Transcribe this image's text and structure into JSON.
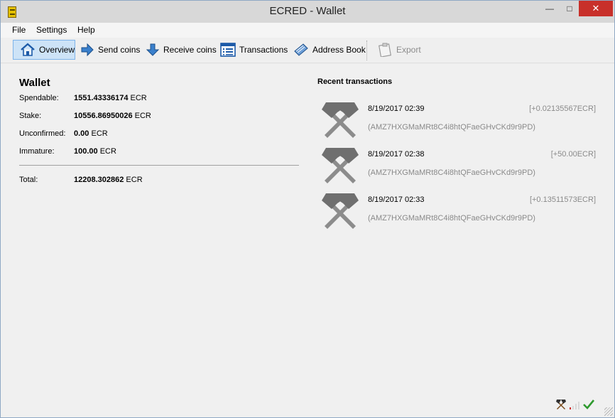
{
  "window": {
    "title": "ECRED - Wallet",
    "min_glyph": "—",
    "max_glyph": "□",
    "close_glyph": "✕"
  },
  "menu": {
    "items": [
      "File",
      "Settings",
      "Help"
    ]
  },
  "toolbar": {
    "overview": "Overview",
    "send": "Send coins",
    "receive": "Receive coins",
    "transactions": "Transactions",
    "address_book": "Address Book",
    "export": "Export"
  },
  "wallet": {
    "title": "Wallet",
    "spendable_label": "Spendable:",
    "spendable_value": "1551.43336174",
    "stake_label": "Stake:",
    "stake_value": "10556.86950026",
    "unconfirmed_label": "Unconfirmed:",
    "unconfirmed_value": "0.00",
    "immature_label": "Immature:",
    "immature_value": "100.00",
    "total_label": "Total:",
    "total_value": "12208.302862",
    "unit": "ECR"
  },
  "recent": {
    "title": "Recent transactions",
    "items": [
      {
        "date": "8/19/2017 02:39",
        "amount": "[+0.02135567",
        "unit": "ECR]",
        "address": "(AMZ7HXGMaMRt8C4i8htQFaeGHvCKd9r9PD)"
      },
      {
        "date": "8/19/2017 02:38",
        "amount": "[+50.00",
        "unit": "ECR]",
        "address": "(AMZ7HXGMaMRt8C4i8htQFaeGHvCKd9r9PD)"
      },
      {
        "date": "8/19/2017 02:33",
        "amount": "[+0.13511573",
        "unit": "ECR]",
        "address": "(AMZ7HXGMaMRt8C4i8htQFaeGHvCKd9r9PD)"
      }
    ]
  },
  "colors": {
    "accent": "#cde3f7",
    "close_button": "#c8302a",
    "muted_text": "#8a8a8a",
    "tx_icon": "#8c8c8c"
  },
  "icons": {
    "overview": "home-icon",
    "send": "send-arrow-icon",
    "receive": "receive-arrow-icon",
    "transactions": "list-icon",
    "address_book": "address-book-icon",
    "export": "export-icon",
    "tx": "hammers-icon",
    "status_mining": "mining-icon",
    "status_signal": "signal-icon",
    "status_sync": "sync-check-icon"
  }
}
